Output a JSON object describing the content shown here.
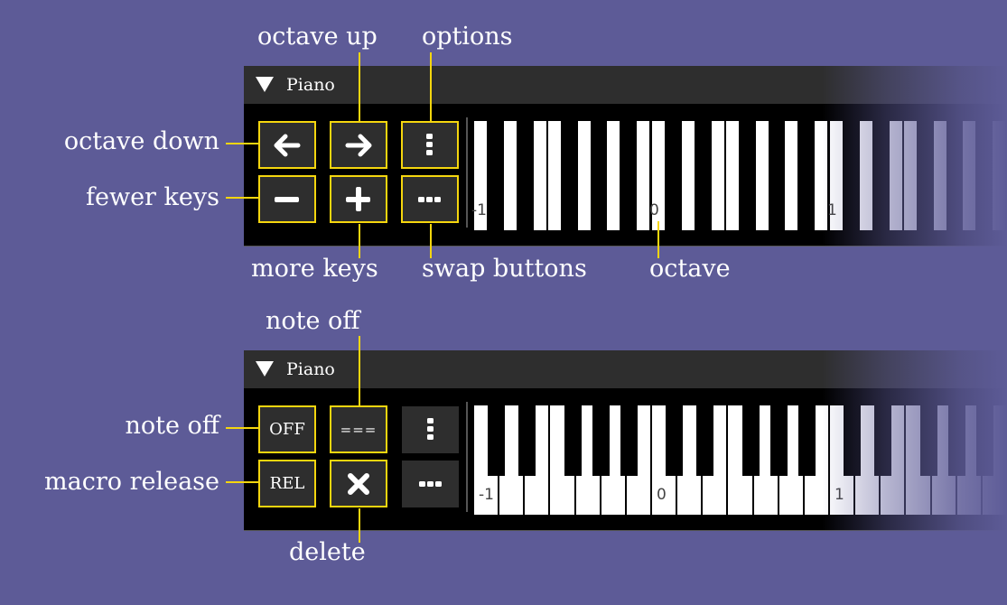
{
  "panels": [
    {
      "title": "Piano",
      "octave_labels": [
        "-1",
        "0",
        "1"
      ],
      "mode": "compact",
      "buttons": [
        {
          "id": "octave-down",
          "icon": "arrow-left-icon",
          "label": ""
        },
        {
          "id": "octave-up",
          "icon": "arrow-right-icon",
          "label": ""
        },
        {
          "id": "options",
          "icon": "vertical-dots-icon",
          "label": ""
        },
        {
          "id": "fewer-keys",
          "icon": "minus-icon",
          "label": ""
        },
        {
          "id": "more-keys",
          "icon": "plus-icon",
          "label": ""
        },
        {
          "id": "swap-buttons",
          "icon": "horizontal-dots-icon",
          "label": ""
        }
      ]
    },
    {
      "title": "Piano",
      "octave_labels": [
        "-1",
        "0",
        "1"
      ],
      "mode": "full",
      "buttons": [
        {
          "id": "note-off",
          "icon": "",
          "label": "OFF"
        },
        {
          "id": "note-off-alt",
          "icon": "",
          "label": "==="
        },
        {
          "id": "options",
          "icon": "vertical-dots-icon",
          "label": ""
        },
        {
          "id": "macro-release",
          "icon": "",
          "label": "REL"
        },
        {
          "id": "delete",
          "icon": "close-x-icon",
          "label": ""
        },
        {
          "id": "swap-buttons",
          "icon": "horizontal-dots-icon",
          "label": ""
        }
      ]
    }
  ],
  "annotations": {
    "octave_up": "octave up",
    "options": "options",
    "octave_down": "octave down",
    "fewer_keys": "fewer keys",
    "more_keys": "more keys",
    "swap_buttons": "swap buttons",
    "octave": "octave",
    "note_off_top": "note off",
    "note_off_left": "note off",
    "macro_release": "macro release",
    "delete": "delete"
  },
  "colors": {
    "background": "#5d5b97",
    "highlight": "#f5d60e",
    "panel_header": "#2e2e2e",
    "button": "#2e2e2e"
  }
}
